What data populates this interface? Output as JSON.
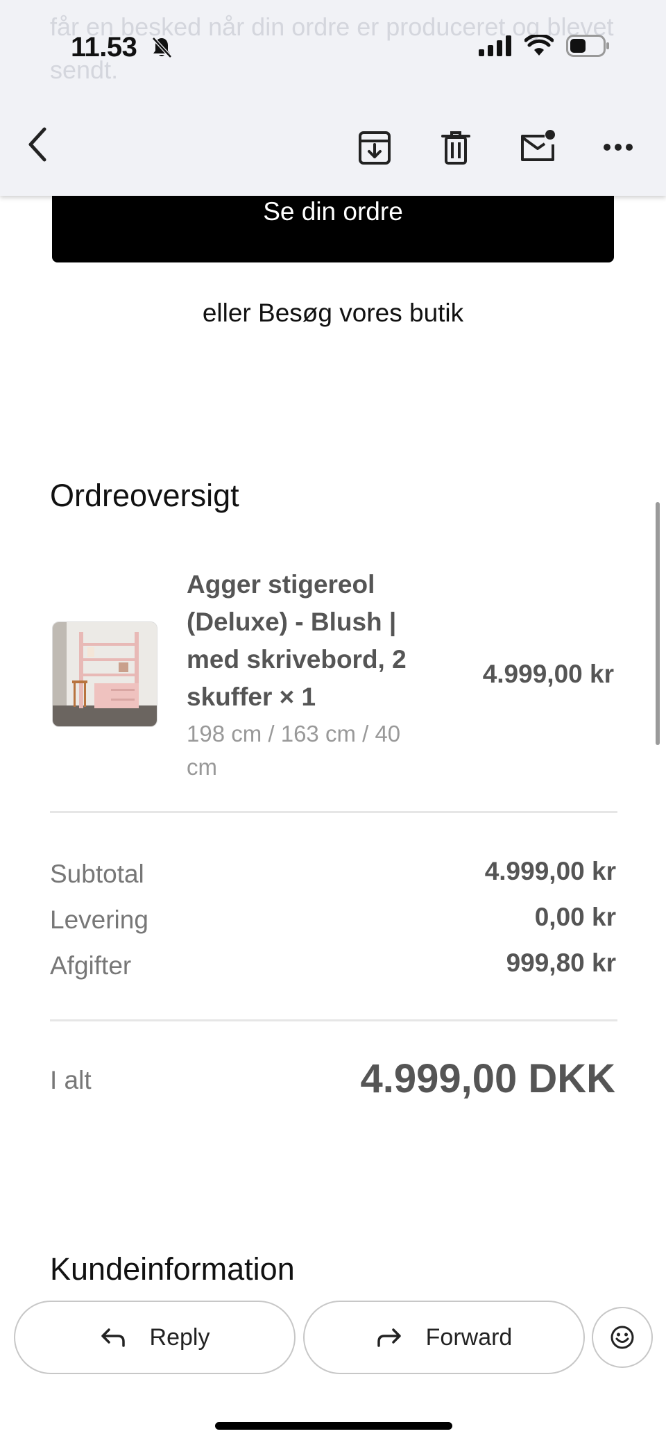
{
  "status_bar": {
    "time": "11.53",
    "icons": [
      "bell-slash-icon",
      "cellular-signal-icon",
      "wifi-icon",
      "battery-icon"
    ]
  },
  "toolbar": {
    "background_text": "får en besked når din ordre er produceret og blevet sendt.",
    "icons": [
      "back-chevron-icon",
      "archive-icon",
      "trash-icon",
      "mark-unread-icon",
      "more-icon"
    ]
  },
  "cta": {
    "view_order": "Se din ordre"
  },
  "visit_store": "eller Besøg vores butik",
  "order_summary": {
    "title": "Ordreoversigt",
    "product": {
      "title": "Agger stigereol (Deluxe) - Blush | med skrivebord, 2 skuffer × 1",
      "variant": "198 cm / 163 cm / 40 cm",
      "price": "4.999,00 kr"
    },
    "subtotal_label": "Subtotal",
    "subtotal_value": "4.999,00 kr",
    "shipping_label": "Levering",
    "shipping_value": "0,00 kr",
    "taxes_label": "Afgifter",
    "taxes_value": "999,80 kr",
    "total_label": "I alt",
    "total_value": "4.999,00 DKK"
  },
  "customer_info": {
    "title": "Kundeinformation"
  },
  "actions": {
    "reply": "Reply",
    "forward": "Forward"
  },
  "colors": {
    "topbar_bg": "#f1f2f6",
    "button_bg": "#000000",
    "muted_text": "#777777",
    "value_text": "#555555"
  }
}
